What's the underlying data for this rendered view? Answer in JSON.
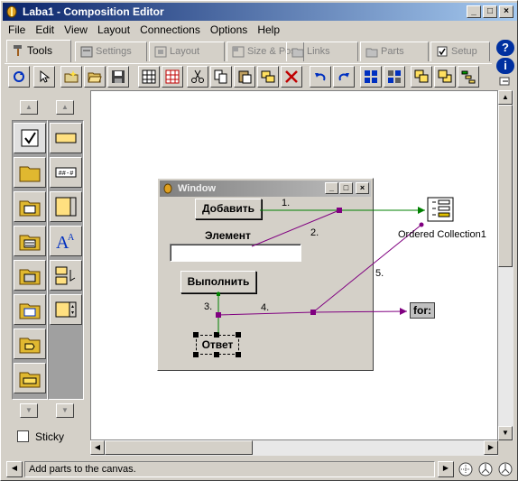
{
  "window": {
    "title": "Laba1 - Composition Editor"
  },
  "menu": [
    "File",
    "Edit",
    "View",
    "Layout",
    "Connections",
    "Options",
    "Help"
  ],
  "tabs": [
    {
      "label": "Tools",
      "active": true
    },
    {
      "label": "Settings",
      "active": false
    },
    {
      "label": "Layout",
      "active": false
    },
    {
      "label": "Size & Pos",
      "active": false
    },
    {
      "label": "Links",
      "active": false
    },
    {
      "label": "Parts",
      "active": false
    },
    {
      "label": "Setup",
      "active": false
    }
  ],
  "palette": {
    "sticky_label": "Sticky"
  },
  "canvas": {
    "window_part": {
      "title": "Window",
      "add_button": "Добавить",
      "element_label": "Элемент",
      "element_value": "",
      "execute_button": "Выполнить",
      "answer_label": "Ответ"
    },
    "ordered_collection_label": "Ordered Collection1",
    "for_label": "for:",
    "connections": [
      "1.",
      "2.",
      "3.",
      "4.",
      "5."
    ]
  },
  "status": {
    "text": "Add parts to the canvas."
  },
  "colors": {
    "title_active": "#0a246a",
    "connection_green": "#008000",
    "connection_purple": "#800080"
  }
}
